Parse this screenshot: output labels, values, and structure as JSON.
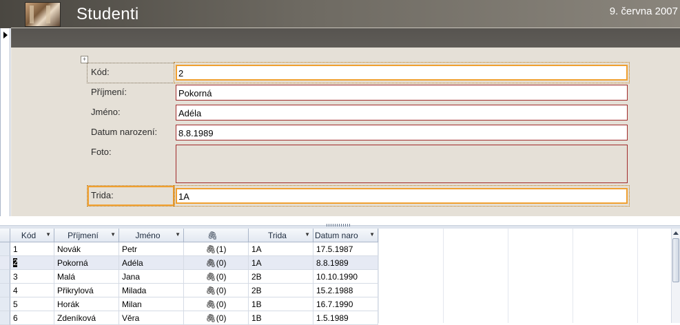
{
  "header": {
    "title": "Studenti",
    "date": "9. června 2007"
  },
  "form": {
    "labels": {
      "kod": "Kód:",
      "prijmeni": "Příjmení:",
      "jmeno": "Jméno:",
      "datum": "Datum narození:",
      "foto": "Foto:",
      "trida": "Trida:"
    },
    "values": {
      "kod": "2",
      "prijmeni": "Pokorná",
      "jmeno": "Adéla",
      "datum": "8.8.1989",
      "trida": "1A"
    }
  },
  "datasheet": {
    "columns": [
      "Kód",
      "Příjmení",
      "Jméno",
      "",
      "Trida",
      "Datum naro"
    ],
    "rows": [
      {
        "kod": "1",
        "prijmeni": "Novák",
        "jmeno": "Petr",
        "att": "(1)",
        "trida": "1A",
        "datum": "17.5.1987"
      },
      {
        "kod": "2",
        "prijmeni": "Pokorná",
        "jmeno": "Adéla",
        "att": "(0)",
        "trida": "1A",
        "datum": "8.8.1989"
      },
      {
        "kod": "3",
        "prijmeni": "Malá",
        "jmeno": "Jana",
        "att": "(0)",
        "trida": "2B",
        "datum": "10.10.1990"
      },
      {
        "kod": "4",
        "prijmeni": "Přikrylová",
        "jmeno": "Milada",
        "att": "(0)",
        "trida": "2B",
        "datum": "15.2.1988"
      },
      {
        "kod": "5",
        "prijmeni": "Horák",
        "jmeno": "Milan",
        "att": "(0)",
        "trida": "1B",
        "datum": "16.7.1990"
      },
      {
        "kod": "6",
        "prijmeni": "Zdeníková",
        "jmeno": "Věra",
        "att": "(0)",
        "trida": "1B",
        "datum": "1.5.1989"
      }
    ],
    "current_row": 2
  },
  "icons": {
    "attachment": "paperclip-icon",
    "record_selector": "record-pointer-icon"
  },
  "colors": {
    "active_border": "#f0a030",
    "field_border": "#a02a2a",
    "form_background": "#e5e0d7"
  }
}
